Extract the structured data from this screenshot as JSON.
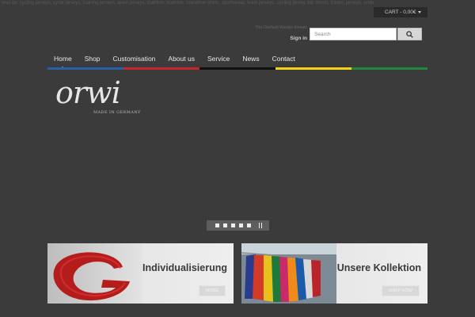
{
  "topbar": {
    "seo_text": "orwi.de: cycling jerseys, cycle jerseys, training jerseys, team jerseys, triathlon, triathlon, marathon shirts, sportswear, team jerseys, cycling jersey, bib shorts, trikots, jerseys, embroidery...",
    "cart_label": "CART - 0,00€"
  },
  "header": {
    "welcome_text": "This Doofield Warden domain",
    "signin_label": "Sign in",
    "search_placeholder": "Search"
  },
  "nav": {
    "items": [
      "Home",
      "Shop",
      "Customisation",
      "About us",
      "Service",
      "News",
      "Contact"
    ],
    "active_index": 0
  },
  "stripe_colors": [
    "#2461a8",
    "#c4262d",
    "#111111",
    "#f2d116",
    "#1e8a3a"
  ],
  "logo": {
    "wordmark": "orwi",
    "tagline": "MADE IN GERMANY"
  },
  "slider": {
    "dot_count": 5
  },
  "banners": [
    {
      "title": "Individualisierung",
      "button_label": "MORE"
    },
    {
      "title": "Unsere Kollektion",
      "button_label": "SHOP NOW"
    }
  ]
}
